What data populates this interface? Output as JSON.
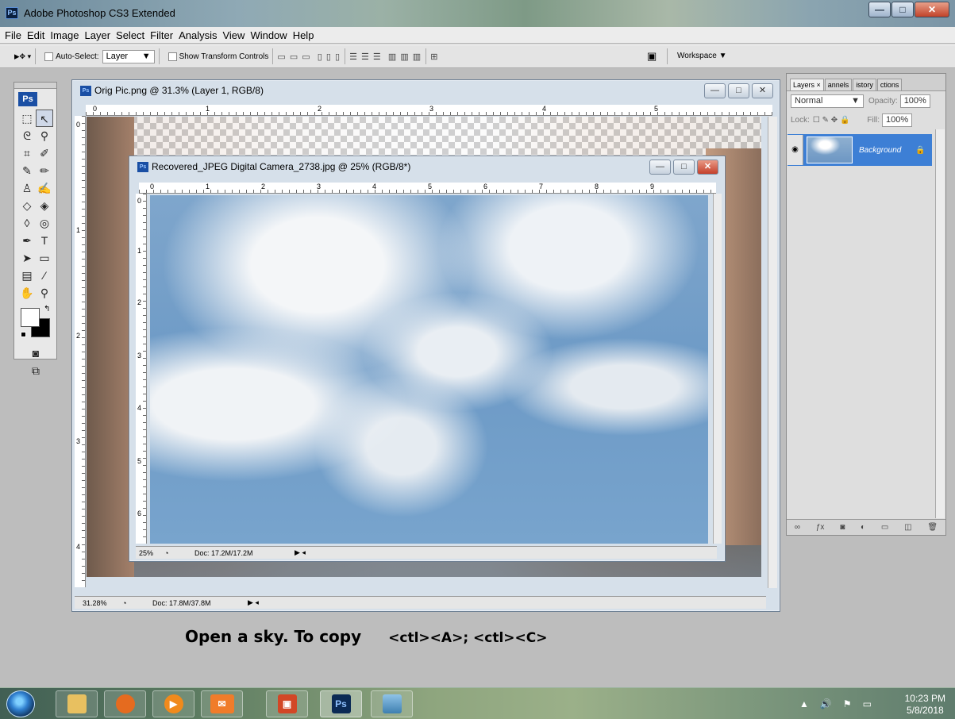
{
  "window": {
    "app_badge": "Ps",
    "title": "Adobe Photoshop CS3 Extended"
  },
  "menu": [
    "File",
    "Edit",
    "Image",
    "Layer",
    "Select",
    "Filter",
    "Analysis",
    "View",
    "Window",
    "Help"
  ],
  "options": {
    "auto_select_label": "Auto-Select:",
    "auto_select_value": "Layer",
    "show_transform_label": "Show Transform Controls",
    "workspace_label": "Workspace ▼"
  },
  "toolbox": {
    "logo": "Ps"
  },
  "doc1": {
    "icon": "Ps",
    "title": "Orig Pic.png @ 31.3% (Layer 1, RGB/8)",
    "ruler_h": [
      "0",
      "1",
      "2",
      "3",
      "4",
      "5"
    ],
    "ruler_v": [
      "0",
      "1",
      "2",
      "3",
      "4"
    ],
    "zoom": "31.28%",
    "doc_size": "Doc: 17.8M/37.8M"
  },
  "doc2": {
    "icon": "Ps",
    "title": "Recovered_JPEG Digital Camera_2738.jpg @ 25% (RGB/8*)",
    "ruler_h": [
      "0",
      "1",
      "2",
      "3",
      "4",
      "5",
      "6",
      "7",
      "8",
      "9"
    ],
    "ruler_v": [
      "0",
      "1",
      "2",
      "3",
      "4",
      "5",
      "6"
    ],
    "zoom": "25%",
    "doc_size": "Doc: 17.2M/17.2M"
  },
  "layers_panel": {
    "tabs": [
      "Layers ×",
      "annels",
      "istory",
      "ctions"
    ],
    "blend_mode": "Normal",
    "opacity_label": "Opacity:",
    "opacity_value": "100%",
    "lock_label": "Lock:",
    "fill_label": "Fill:",
    "fill_value": "100%",
    "layer_name": "Background"
  },
  "caption": {
    "main": "Open a sky.  To copy",
    "shortcut": "<ctl><A>; <ctl><C>"
  },
  "taskbar": {
    "ps_label": "Ps",
    "time": "10:23 PM",
    "date": "5/8/2018"
  }
}
